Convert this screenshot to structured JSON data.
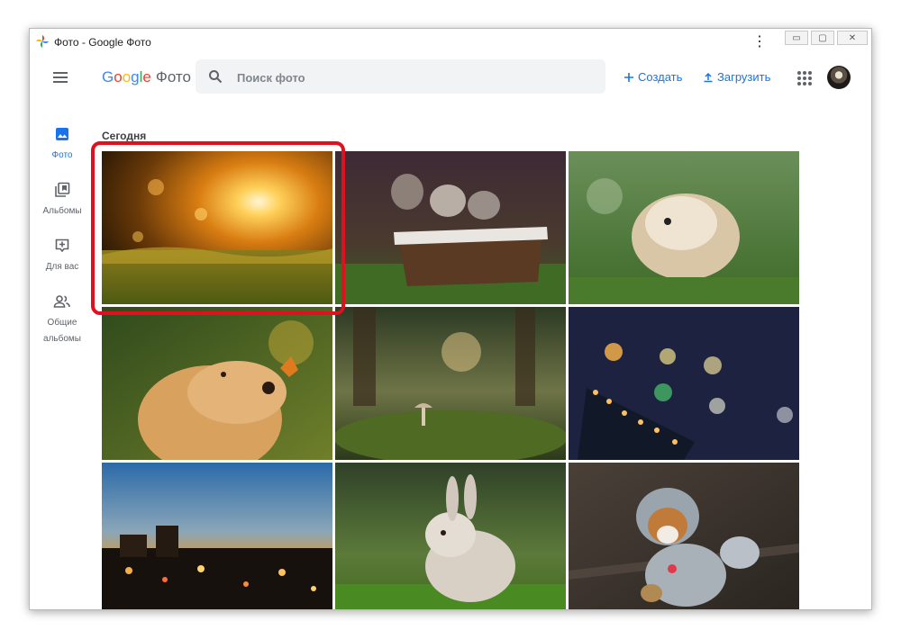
{
  "window": {
    "title": "Фото - Google Фото",
    "menu_glyph": "⋮",
    "controls": [
      "▭",
      "▢",
      "✕"
    ]
  },
  "header": {
    "logo_parts": [
      "G",
      "o",
      "o",
      "g",
      "l",
      "e"
    ],
    "product": "Фото",
    "search_placeholder": "Поиск фото",
    "create_label": "Создать",
    "upload_label": "Загрузить"
  },
  "sidebar": {
    "items": [
      {
        "label": "Фото",
        "icon": "photo-icon",
        "active": true
      },
      {
        "label": "Альбомы",
        "icon": "albums-icon"
      },
      {
        "label": "Для вас",
        "icon": "for-you-icon"
      },
      {
        "label": "Общие альбомы",
        "icon": "shared-albums-icon"
      }
    ]
  },
  "section": {
    "title": "Сегодня"
  },
  "photos": [
    {
      "name": "sunset-forest-photo"
    },
    {
      "name": "kittens-basket-photo"
    },
    {
      "name": "guinea-pig-photo"
    },
    {
      "name": "dog-butterfly-photo"
    },
    {
      "name": "mushroom-moss-photo"
    },
    {
      "name": "bokeh-lights-photo"
    },
    {
      "name": "city-night-photo"
    },
    {
      "name": "rabbit-photo"
    },
    {
      "name": "dog-costume-photo"
    }
  ]
}
